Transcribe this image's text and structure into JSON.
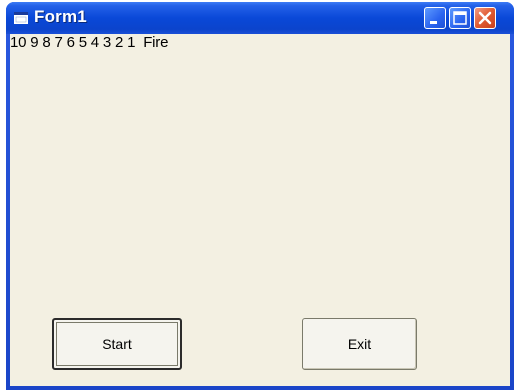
{
  "window": {
    "title": "Form1",
    "controls": {
      "minimize_icon": "minimize-icon",
      "maximize_icon": "maximize-icon",
      "close_icon": "close-icon"
    }
  },
  "form": {
    "countdown_text": "10 9 8 7 6 5 4 3 2 1  Fire",
    "start_label": "Start",
    "exit_label": "Exit"
  },
  "colors": {
    "titlebar": "#0a48d8",
    "close_button": "#e05a32",
    "client_background": "#f3f0e2"
  }
}
